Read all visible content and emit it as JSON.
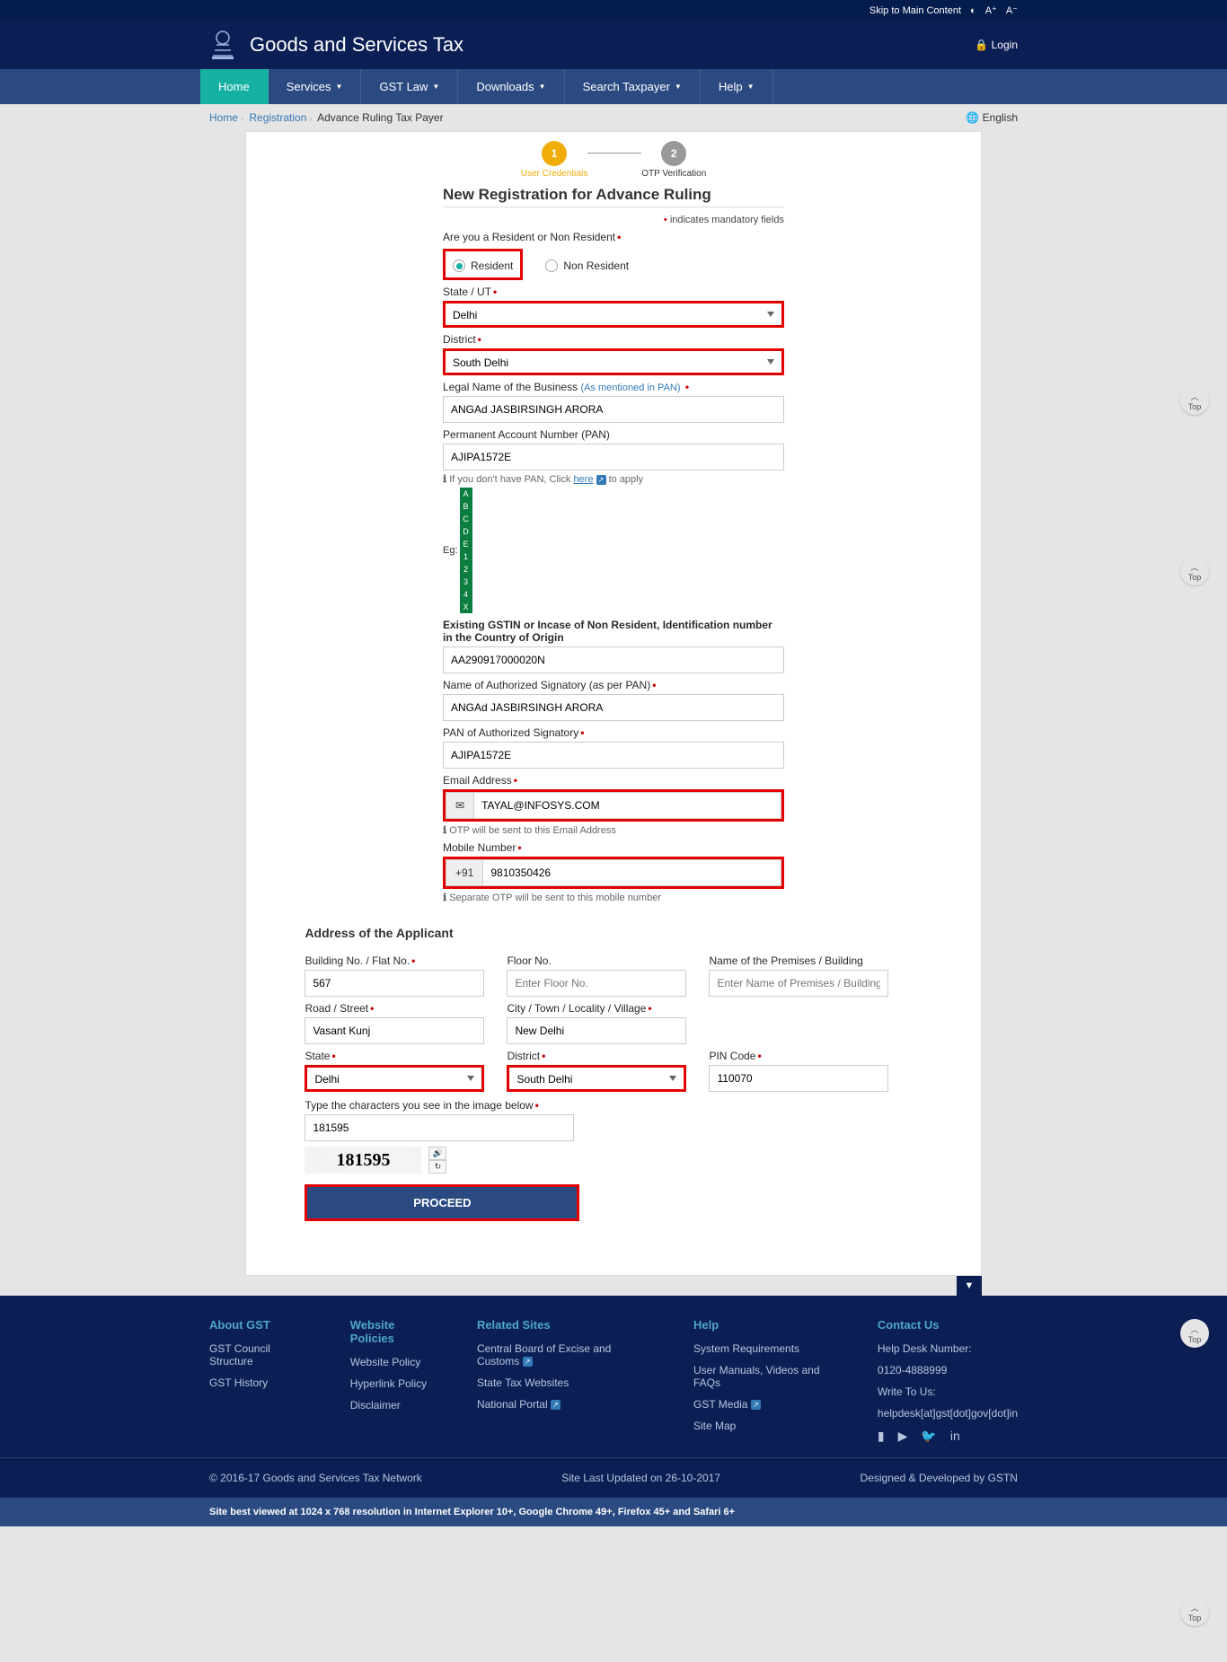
{
  "topbar": {
    "skip": "Skip to Main Content",
    "a_plus": "A⁺",
    "a_minus": "A⁻"
  },
  "header": {
    "title": "Goods and Services Tax",
    "login": "Login"
  },
  "nav": {
    "home": "Home",
    "services": "Services",
    "gst_law": "GST Law",
    "downloads": "Downloads",
    "search": "Search Taxpayer",
    "help": "Help"
  },
  "breadcrumb": {
    "home": "Home",
    "reg": "Registration",
    "current": "Advance Ruling Tax Payer",
    "lang": "English"
  },
  "steps": {
    "s1_num": "1",
    "s1_label": "User Credentials",
    "s2_num": "2",
    "s2_label": "OTP Verification"
  },
  "form": {
    "title": "New Registration for Advance Ruling",
    "mandatory": "indicates mandatory fields",
    "resident_q": "Are you a Resident or Non Resident",
    "resident": "Resident",
    "non_resident": "Non Resident",
    "state_label": "State / UT",
    "state_val": "Delhi",
    "district_label": "District",
    "district_val": "South Delhi",
    "legal_name_label": "Legal Name of the Business",
    "as_per_pan": "(As mentioned in PAN)",
    "legal_name_val": "ANGAd JASBIRSINGH ARORA",
    "pan_label": "Permanent Account Number (PAN)",
    "pan_val": "AJIPA1572E",
    "pan_hint_pre": "If you don't have PAN, Click ",
    "pan_hint_link": "here",
    "pan_hint_post": " to apply",
    "eg_label": "Eg:",
    "eg_chars": [
      "A",
      "B",
      "C",
      "D",
      "E",
      "1",
      "2",
      "3",
      "4",
      "X"
    ],
    "gstin_label": "Existing GSTIN or Incase of Non Resident, Identification number in the Country of Origin",
    "gstin_val": "AA290917000020N",
    "auth_name_label": "Name of Authorized Signatory (as per PAN)",
    "auth_name_val": "ANGAd JASBIRSINGH ARORA",
    "auth_pan_label": "PAN of Authorized Signatory",
    "auth_pan_val": "AJIPA1572E",
    "email_label": "Email Address",
    "email_val": "TAYAL@INFOSYS.COM",
    "email_hint": "OTP will be sent to this Email Address",
    "mobile_label": "Mobile Number",
    "mobile_prefix": "+91",
    "mobile_val": "9810350426",
    "mobile_hint": "Separate OTP will be sent to this mobile number"
  },
  "address": {
    "title": "Address of the Applicant",
    "building_label": "Building No. / Flat No.",
    "building_val": "567",
    "floor_label": "Floor No.",
    "floor_ph": "Enter Floor No.",
    "premises_label": "Name of the Premises / Building",
    "premises_ph": "Enter Name of Premises / Building",
    "road_label": "Road / Street",
    "road_val": "Vasant Kunj",
    "city_label": "City / Town / Locality / Village",
    "city_val": "New Delhi",
    "state_label": "State",
    "state_val": "Delhi",
    "district_label": "District",
    "district_val": "South Delhi",
    "pin_label": "PIN Code",
    "pin_val": "110070",
    "captcha_label": "Type the characters you see in the image below",
    "captcha_val": "181595",
    "captcha_img": "181595",
    "proceed": "PROCEED"
  },
  "footer": {
    "about_h": "About GST",
    "about_1": "GST Council Structure",
    "about_2": "GST History",
    "policies_h": "Website Policies",
    "policies_1": "Website Policy",
    "policies_2": "Hyperlink Policy",
    "policies_3": "Disclaimer",
    "related_h": "Related Sites",
    "related_1": "Central Board of Excise and Customs",
    "related_2": "State Tax Websites",
    "related_3": "National Portal",
    "help_h": "Help",
    "help_1": "System Requirements",
    "help_2": "User Manuals, Videos and FAQs",
    "help_3": "GST Media",
    "help_4": "Site Map",
    "contact_h": "Contact Us",
    "contact_1": "Help Desk Number:",
    "contact_2": "0120-4888999",
    "contact_3": "Write To Us:",
    "contact_4": "helpdesk[at]gst[dot]gov[dot]in",
    "copyright": "© 2016-17 Goods and Services Tax Network",
    "updated": "Site Last Updated on 26-10-2017",
    "designed": "Designed & Developed by GSTN",
    "note": "Site best viewed at 1024 x 768 resolution in Internet Explorer 10+, Google Chrome 49+, Firefox 45+ and Safari 6+"
  },
  "top_btn": "Top"
}
